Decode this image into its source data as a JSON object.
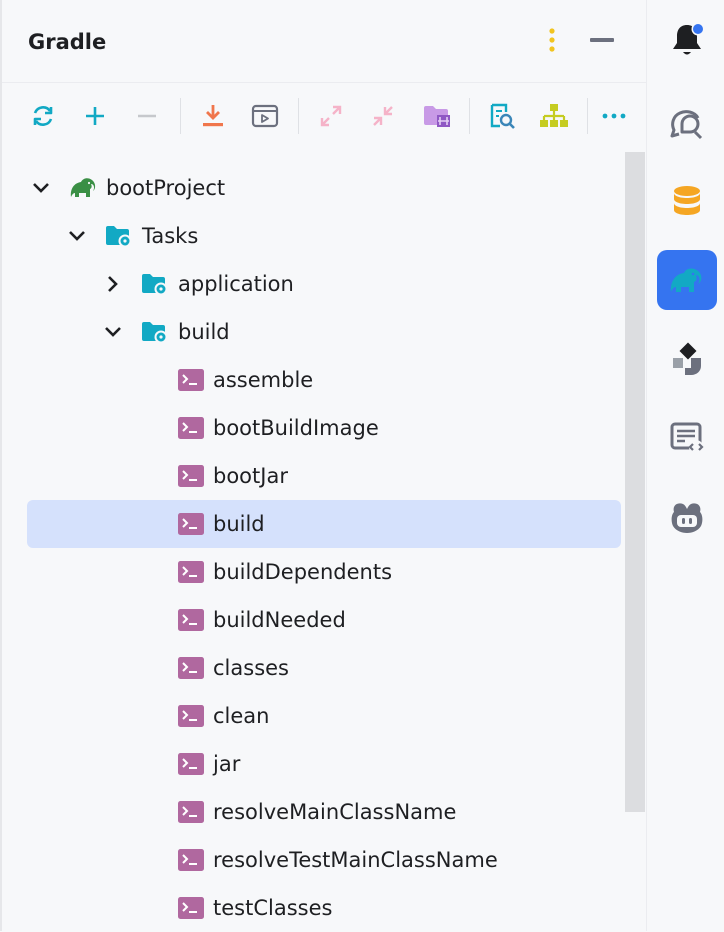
{
  "header": {
    "title": "Gradle"
  },
  "toolbar": {
    "buttons": [
      {
        "name": "reload-icon"
      },
      {
        "name": "add-icon"
      },
      {
        "name": "remove-icon"
      },
      {
        "name": "download-icon"
      },
      {
        "name": "run-config-icon"
      },
      {
        "name": "expand-all-icon"
      },
      {
        "name": "collapse-all-icon"
      },
      {
        "name": "folder-settings-icon"
      },
      {
        "name": "analyze-icon"
      },
      {
        "name": "hierarchy-icon"
      },
      {
        "name": "more-icon"
      }
    ]
  },
  "tree": {
    "root": "bootProject",
    "tasks": "Tasks",
    "application": "application",
    "build": "build",
    "items": [
      "assemble",
      "bootBuildImage",
      "bootJar",
      "build",
      "buildDependents",
      "buildNeeded",
      "classes",
      "clean",
      "jar",
      "resolveMainClassName",
      "resolveTestMainClassName",
      "testClasses"
    ],
    "selected_index": 3
  },
  "rightbar": {
    "items": [
      {
        "name": "notifications-icon"
      },
      {
        "name": "ai-chat-icon"
      },
      {
        "name": "database-icon"
      },
      {
        "name": "gradle-icon",
        "active": true
      },
      {
        "name": "plugin-icon"
      },
      {
        "name": "endpoints-icon"
      },
      {
        "name": "copilot-icon"
      }
    ]
  },
  "colors": {
    "accent": "#3574f0",
    "selection": "#d5e1fc",
    "task_icon": "#b0689f",
    "folder_icon": "#12a9c4",
    "gradle_green": "#3a8f45"
  }
}
